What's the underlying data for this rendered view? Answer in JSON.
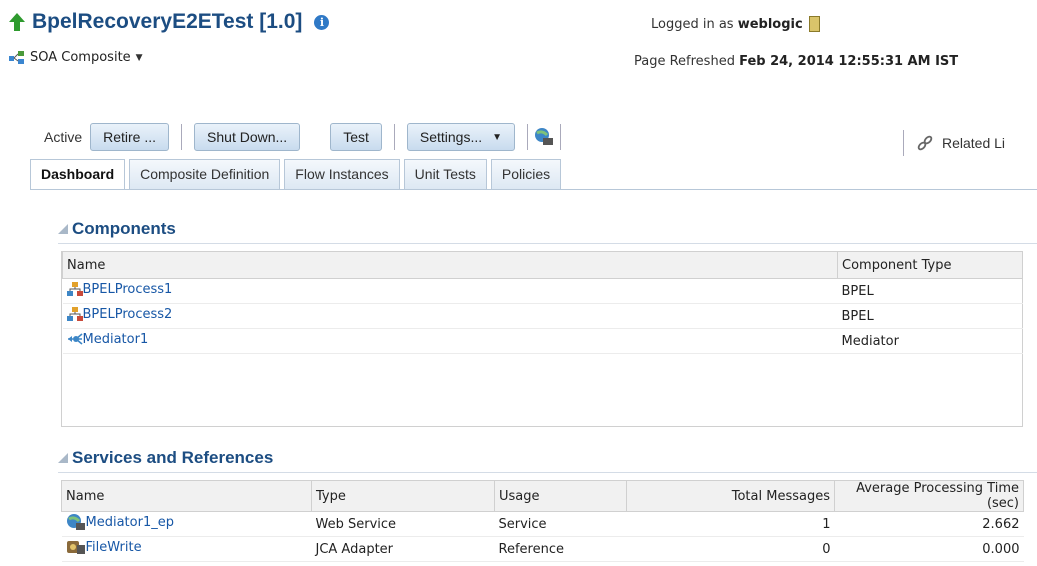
{
  "header": {
    "title": "BpelRecoveryE2ETest [1.0]",
    "subtitle": "SOA Composite",
    "login_prefix": "Logged in as",
    "login_user": "weblogic",
    "refresh_prefix": "Page Refreshed",
    "refresh_time": "Feb 24, 2014 12:55:31 AM IST"
  },
  "toolbar": {
    "status": "Active",
    "retire": "Retire ...",
    "shutdown": "Shut Down...",
    "test": "Test",
    "settings": "Settings...",
    "related": "Related Li"
  },
  "tabs": [
    "Dashboard",
    "Composite Definition",
    "Flow Instances",
    "Unit Tests",
    "Policies"
  ],
  "components": {
    "title": "Components",
    "headers": [
      "Name",
      "Component Type"
    ],
    "rows": [
      {
        "name": "BPELProcess1",
        "type": "BPEL",
        "icon": "bpel-process-icon"
      },
      {
        "name": "BPELProcess2",
        "type": "BPEL",
        "icon": "bpel-process-icon"
      },
      {
        "name": "Mediator1",
        "type": "Mediator",
        "icon": "mediator-icon"
      }
    ]
  },
  "services": {
    "title": "Services and References",
    "headers": [
      "Name",
      "Type",
      "Usage",
      "Total Messages",
      "Average Processing Time (sec)"
    ],
    "rows": [
      {
        "name": "Mediator1_ep",
        "type": "Web Service",
        "usage": "Service",
        "total": "1",
        "avg": "2.662",
        "icon": "web-service-icon"
      },
      {
        "name": "FileWrite",
        "type": "JCA Adapter",
        "usage": "Reference",
        "total": "0",
        "avg": "0.000",
        "icon": "jca-adapter-icon"
      }
    ]
  },
  "colors": {
    "accent": "#1c4d82",
    "link": "#1757a6"
  }
}
